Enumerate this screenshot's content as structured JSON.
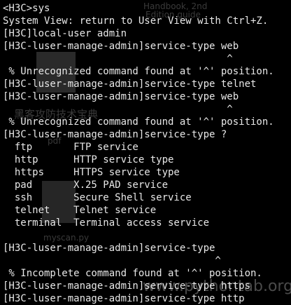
{
  "terminal": {
    "lines": [
      "<H3C>sys",
      "System View: return to User View with Ctrl+Z.",
      "[H3C]local-user admin",
      "[H3C-luser-manage-admin]service-type web",
      "                                      ^",
      " % Unrecognized command found at '^' position.",
      "[H3C-luser-manage-admin]service-type telnet",
      "[H3C-luser-manage-admin]service-type web",
      "                                      ^",
      " % Unrecognized command found at '^' position.",
      "[H3C-luser-manage-admin]service-type ?",
      "  ftp       FTP service",
      "  http      HTTP service type",
      "  https     HTTPS service type",
      "  pad       X.25 PAD service",
      "  ssh       Secure Shell service",
      "  telnet    Telnet service",
      "  terminal  Terminal access service",
      "",
      "[H3C-luser-manage-admin]service-type",
      "                                    ^",
      " % Incomplete command found at '^' position.",
      "[H3C-luser-manage-admin]service-type https",
      "[H3C-luser-manage-admin]service-type http"
    ]
  },
  "watermarks": {
    "handbook": "Handbook, 2nd",
    "edition": "Edition guide",
    "hacker": "黑客攻防技术宝典",
    "pdf": "pdf",
    "myscan": "myscan.py",
    "site": "www.pythontab.org"
  },
  "colors": {
    "background": "#000000",
    "text": "#e8e8e8"
  }
}
